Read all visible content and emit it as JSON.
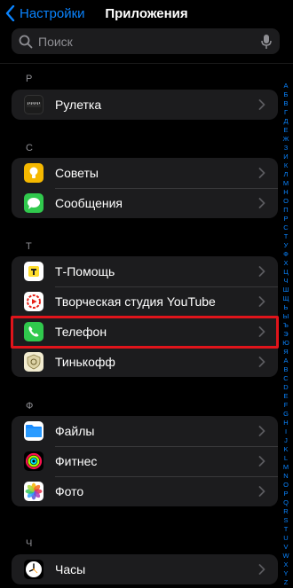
{
  "header": {
    "back_label": "Настройки",
    "title": "Приложения"
  },
  "search": {
    "placeholder": "Поиск"
  },
  "sections": [
    {
      "letter": "Р",
      "items": [
        {
          "label": "Рулетка",
          "icon": "ruler-icon"
        }
      ]
    },
    {
      "letter": "С",
      "items": [
        {
          "label": "Советы",
          "icon": "tips-icon"
        },
        {
          "label": "Сообщения",
          "icon": "messages-icon"
        }
      ]
    },
    {
      "letter": "Т",
      "items": [
        {
          "label": "Т-Помощь",
          "icon": "t-help-icon"
        },
        {
          "label": "Творческая студия YouTube",
          "icon": "youtube-studio-icon"
        },
        {
          "label": "Телефон",
          "icon": "phone-icon"
        },
        {
          "label": "Тинькофф",
          "icon": "tinkoff-icon"
        }
      ]
    },
    {
      "letter": "Ф",
      "items": [
        {
          "label": "Файлы",
          "icon": "files-icon"
        },
        {
          "label": "Фитнес",
          "icon": "fitness-icon"
        },
        {
          "label": "Фото",
          "icon": "photos-icon"
        }
      ]
    },
    {
      "letter": "Ч",
      "items": [
        {
          "label": "Часы",
          "icon": "clock-icon"
        }
      ]
    }
  ],
  "index": [
    "А",
    "Б",
    "В",
    "Г",
    "Д",
    "Е",
    "Ж",
    "З",
    "И",
    "К",
    "Л",
    "М",
    "Н",
    "О",
    "П",
    "Р",
    "С",
    "Т",
    "У",
    "Ф",
    "Х",
    "Ц",
    "Ч",
    "Ш",
    "Щ",
    "Ь",
    "Ы",
    "Ъ",
    "Э",
    "Ю",
    "Я",
    "A",
    "B",
    "C",
    "D",
    "E",
    "F",
    "G",
    "H",
    "I",
    "J",
    "K",
    "L",
    "M",
    "N",
    "O",
    "P",
    "Q",
    "R",
    "S",
    "T",
    "U",
    "V",
    "W",
    "X",
    "Y",
    "Z",
    "#"
  ],
  "colors": {
    "accent": "#0a84ff",
    "highlight": "#e0141b",
    "cell_bg": "#1c1c1e"
  }
}
